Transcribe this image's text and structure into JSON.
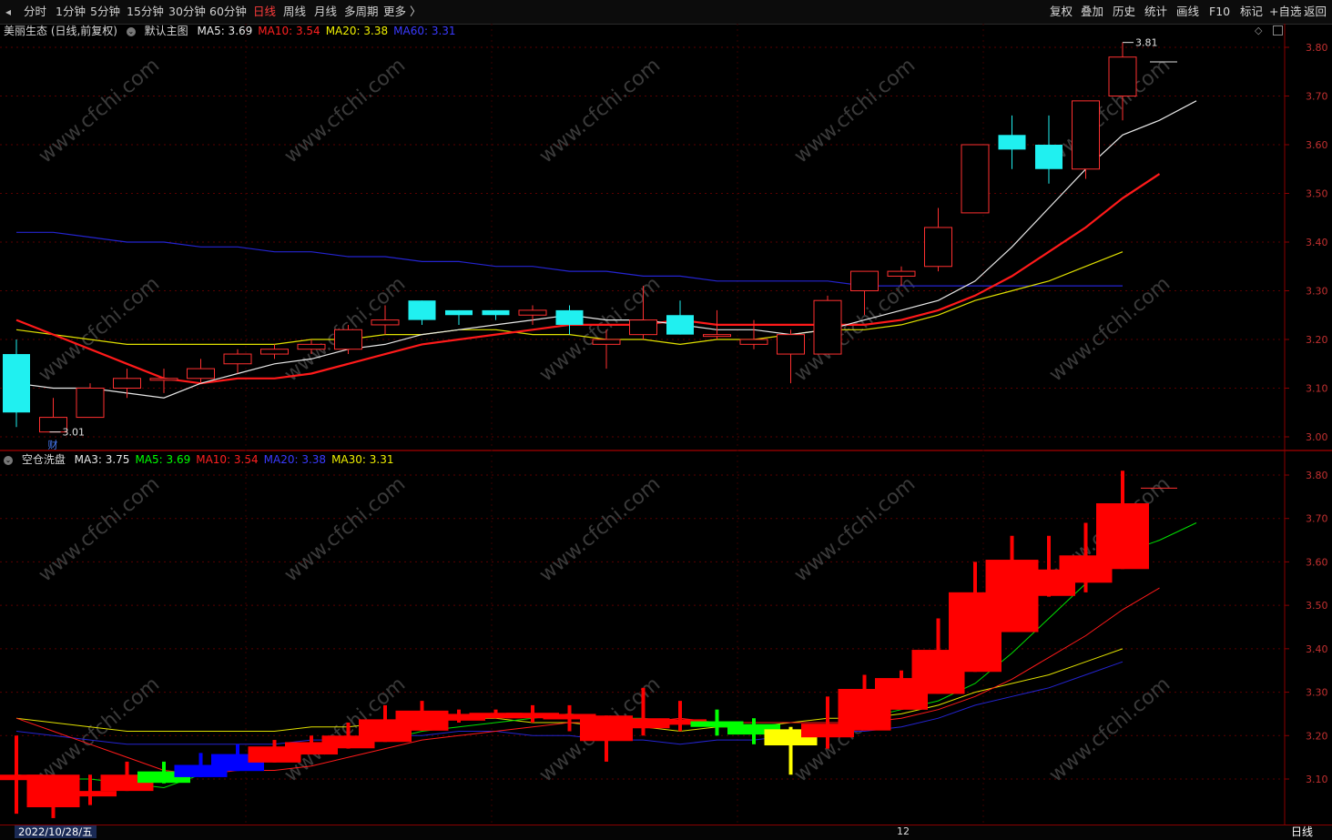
{
  "toolbar": {
    "periods": [
      {
        "label": "分时",
        "active": false
      },
      {
        "label": "1分钟",
        "active": false
      },
      {
        "label": "5分钟",
        "active": false
      },
      {
        "label": "15分钟",
        "active": false
      },
      {
        "label": "30分钟",
        "active": false
      },
      {
        "label": "60分钟",
        "active": false
      },
      {
        "label": "日线",
        "active": true
      },
      {
        "label": "周线",
        "active": false
      },
      {
        "label": "月线",
        "active": false
      },
      {
        "label": "多周期",
        "active": false
      },
      {
        "label": "更多 〉",
        "active": false
      }
    ],
    "right_buttons": [
      "复权",
      "叠加",
      "历史",
      "统计",
      "画线",
      "F10",
      "标记",
      "+自选",
      "返回"
    ]
  },
  "main_panel": {
    "stock": "美丽生态 (日线,前复权)",
    "chart_name": "默认主图",
    "ma": [
      {
        "label": "MA5: 3.69",
        "color": "#e8e8e8"
      },
      {
        "label": "MA10: 3.54",
        "color": "#ff2020"
      },
      {
        "label": "MA20: 3.38",
        "color": "#f0f000"
      },
      {
        "label": "MA60: 3.31",
        "color": "#3a3aff"
      }
    ],
    "high_label": "3.81",
    "low_label": "3.01",
    "fin_badge": "财",
    "y_ticks": [
      "3.80",
      "3.70",
      "3.60",
      "3.50",
      "3.40",
      "3.30",
      "3.20",
      "3.10",
      "3.00"
    ]
  },
  "sub_panel": {
    "name": "空仓洗盘",
    "ma": [
      {
        "label": "MA3: 3.75",
        "color": "#e8e8e8"
      },
      {
        "label": "MA5: 3.69",
        "color": "#00ff00"
      },
      {
        "label": "MA10: 3.54",
        "color": "#ff2020"
      },
      {
        "label": "MA20: 3.38",
        "color": "#3a3aff"
      },
      {
        "label": "MA30: 3.31",
        "color": "#f0f000"
      }
    ],
    "y_ticks": [
      "3.80",
      "3.70",
      "3.60",
      "3.50",
      "3.40",
      "3.30",
      "3.20",
      "3.10"
    ]
  },
  "bottom": {
    "date": "2022/10/28/五",
    "month_tick": "12",
    "period": "日线"
  },
  "watermark": "www.cfchi.com",
  "chart_data": {
    "type": "candlestick",
    "ylim_main": [
      3.0,
      3.81
    ],
    "candles": [
      {
        "o": 3.17,
        "h": 3.2,
        "l": 3.02,
        "c": 3.05
      },
      {
        "o": 3.01,
        "h": 3.08,
        "l": 3.01,
        "c": 3.04
      },
      {
        "o": 3.04,
        "h": 3.11,
        "l": 3.04,
        "c": 3.1
      },
      {
        "o": 3.1,
        "h": 3.14,
        "l": 3.08,
        "c": 3.12
      },
      {
        "o": 3.12,
        "h": 3.14,
        "l": 3.09,
        "c": 3.12
      },
      {
        "o": 3.12,
        "h": 3.16,
        "l": 3.11,
        "c": 3.14
      },
      {
        "o": 3.15,
        "h": 3.18,
        "l": 3.13,
        "c": 3.17
      },
      {
        "o": 3.17,
        "h": 3.19,
        "l": 3.16,
        "c": 3.18
      },
      {
        "o": 3.18,
        "h": 3.2,
        "l": 3.17,
        "c": 3.19
      },
      {
        "o": 3.18,
        "h": 3.23,
        "l": 3.17,
        "c": 3.22
      },
      {
        "o": 3.23,
        "h": 3.27,
        "l": 3.21,
        "c": 3.24
      },
      {
        "o": 3.28,
        "h": 3.28,
        "l": 3.23,
        "c": 3.24
      },
      {
        "o": 3.26,
        "h": 3.26,
        "l": 3.23,
        "c": 3.25
      },
      {
        "o": 3.26,
        "h": 3.26,
        "l": 3.24,
        "c": 3.25
      },
      {
        "o": 3.25,
        "h": 3.27,
        "l": 3.23,
        "c": 3.26
      },
      {
        "o": 3.26,
        "h": 3.27,
        "l": 3.21,
        "c": 3.23
      },
      {
        "o": 3.19,
        "h": 3.22,
        "l": 3.14,
        "c": 3.2
      },
      {
        "o": 3.21,
        "h": 3.31,
        "l": 3.2,
        "c": 3.24
      },
      {
        "o": 3.25,
        "h": 3.28,
        "l": 3.21,
        "c": 3.21
      },
      {
        "o": 3.21,
        "h": 3.26,
        "l": 3.2,
        "c": 3.21
      },
      {
        "o": 3.19,
        "h": 3.24,
        "l": 3.18,
        "c": 3.2
      },
      {
        "o": 3.17,
        "h": 3.22,
        "l": 3.11,
        "c": 3.21
      },
      {
        "o": 3.17,
        "h": 3.29,
        "l": 3.17,
        "c": 3.28
      },
      {
        "o": 3.3,
        "h": 3.34,
        "l": 3.25,
        "c": 3.34
      },
      {
        "o": 3.33,
        "h": 3.35,
        "l": 3.31,
        "c": 3.34
      },
      {
        "o": 3.35,
        "h": 3.47,
        "l": 3.34,
        "c": 3.43
      },
      {
        "o": 3.46,
        "h": 3.6,
        "l": 3.46,
        "c": 3.6
      },
      {
        "o": 3.62,
        "h": 3.66,
        "l": 3.55,
        "c": 3.59
      },
      {
        "o": 3.6,
        "h": 3.66,
        "l": 3.52,
        "c": 3.55
      },
      {
        "o": 3.55,
        "h": 3.69,
        "l": 3.53,
        "c": 3.69
      },
      {
        "o": 3.7,
        "h": 3.81,
        "l": 3.65,
        "c": 3.78
      }
    ],
    "ma5": [
      3.11,
      3.1,
      3.1,
      3.09,
      3.08,
      3.11,
      3.13,
      3.15,
      3.16,
      3.18,
      3.19,
      3.21,
      3.22,
      3.23,
      3.24,
      3.25,
      3.24,
      3.24,
      3.23,
      3.22,
      3.22,
      3.21,
      3.22,
      3.24,
      3.26,
      3.28,
      3.32,
      3.39,
      3.47,
      3.55,
      3.62,
      3.65,
      3.69
    ],
    "ma10": [
      3.24,
      3.21,
      3.18,
      3.15,
      3.12,
      3.11,
      3.12,
      3.12,
      3.13,
      3.15,
      3.17,
      3.19,
      3.2,
      3.21,
      3.22,
      3.23,
      3.23,
      3.23,
      3.24,
      3.23,
      3.23,
      3.23,
      3.23,
      3.23,
      3.24,
      3.26,
      3.29,
      3.33,
      3.38,
      3.43,
      3.49,
      3.54
    ],
    "ma20": [
      3.22,
      3.21,
      3.2,
      3.19,
      3.19,
      3.19,
      3.19,
      3.19,
      3.2,
      3.2,
      3.21,
      3.21,
      3.22,
      3.22,
      3.21,
      3.21,
      3.2,
      3.2,
      3.19,
      3.2,
      3.2,
      3.21,
      3.22,
      3.22,
      3.23,
      3.25,
      3.28,
      3.3,
      3.32,
      3.35,
      3.38
    ],
    "ma60": [
      3.42,
      3.42,
      3.41,
      3.4,
      3.4,
      3.39,
      3.39,
      3.38,
      3.38,
      3.37,
      3.37,
      3.36,
      3.36,
      3.35,
      3.35,
      3.34,
      3.34,
      3.33,
      3.33,
      3.32,
      3.32,
      3.32,
      3.32,
      3.31,
      3.31,
      3.31,
      3.31,
      3.31,
      3.31,
      3.31,
      3.31
    ]
  }
}
